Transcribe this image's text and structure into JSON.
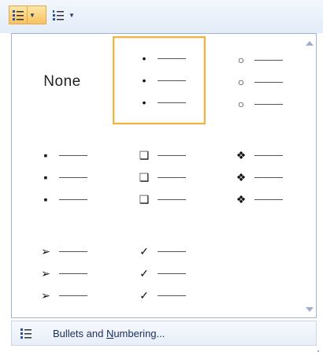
{
  "toolbar": {
    "bullets_button": {
      "icon": "bullet-list-icon",
      "dropdown_icon": "dropdown-arrow-icon",
      "state": "pressed"
    },
    "numbering_button": {
      "icon": "numbered-list-icon",
      "dropdown_icon": "dropdown-arrow-icon"
    }
  },
  "gallery": {
    "none_label": "None",
    "styles": [
      {
        "name": "none",
        "selected": false
      },
      {
        "name": "small-dot",
        "symbol": "•",
        "selected": true
      },
      {
        "name": "hollow-circle",
        "symbol": "○",
        "selected": false
      },
      {
        "name": "square",
        "symbol": "▪",
        "selected": false
      },
      {
        "name": "hollow-square",
        "symbol": "❑",
        "selected": false
      },
      {
        "name": "diamond-dots",
        "symbol": "❖",
        "selected": false
      },
      {
        "name": "arrowhead",
        "symbol": "➢",
        "selected": false
      },
      {
        "name": "checkmark",
        "symbol": "✓",
        "selected": false
      }
    ]
  },
  "footer": {
    "label_pre": "Bullets and ",
    "label_mnemonic": "N",
    "label_post": "umbering..."
  },
  "colors": {
    "selection_border": "#f2b24a",
    "panel_border": "#9fb3d4",
    "toolbar_bg": "#e3ecf8"
  }
}
